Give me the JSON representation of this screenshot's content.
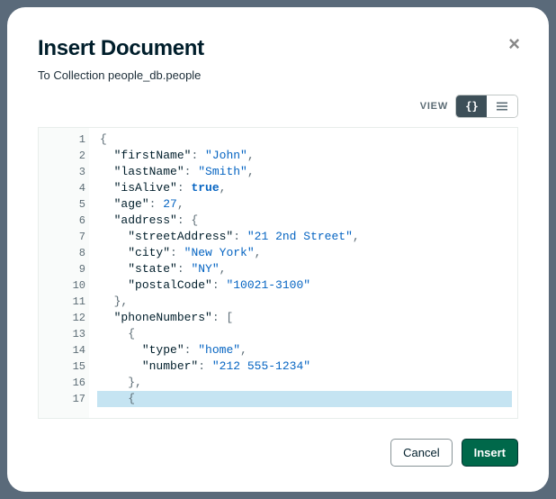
{
  "modal": {
    "title": "Insert Document",
    "subtitle": "To Collection people_db.people",
    "close_icon": "×"
  },
  "view": {
    "label": "VIEW"
  },
  "editor": {
    "lines": [
      {
        "num": "1",
        "fold": true,
        "indent": 0,
        "tokens": [
          [
            "punc",
            "{"
          ]
        ]
      },
      {
        "num": "2",
        "fold": false,
        "indent": 1,
        "tokens": [
          [
            "key",
            "\"firstName\""
          ],
          [
            "punc",
            ": "
          ],
          [
            "str",
            "\"John\""
          ],
          [
            "punc",
            ","
          ]
        ]
      },
      {
        "num": "3",
        "fold": false,
        "indent": 1,
        "tokens": [
          [
            "key",
            "\"lastName\""
          ],
          [
            "punc",
            ": "
          ],
          [
            "str",
            "\"Smith\""
          ],
          [
            "punc",
            ","
          ]
        ]
      },
      {
        "num": "4",
        "fold": false,
        "indent": 1,
        "tokens": [
          [
            "key",
            "\"isAlive\""
          ],
          [
            "punc",
            ": "
          ],
          [
            "bool",
            "true"
          ],
          [
            "punc",
            ","
          ]
        ]
      },
      {
        "num": "5",
        "fold": false,
        "indent": 1,
        "tokens": [
          [
            "key",
            "\"age\""
          ],
          [
            "punc",
            ": "
          ],
          [
            "num",
            "27"
          ],
          [
            "punc",
            ","
          ]
        ]
      },
      {
        "num": "6",
        "fold": true,
        "indent": 1,
        "tokens": [
          [
            "key",
            "\"address\""
          ],
          [
            "punc",
            ": {"
          ]
        ]
      },
      {
        "num": "7",
        "fold": false,
        "indent": 2,
        "tokens": [
          [
            "key",
            "\"streetAddress\""
          ],
          [
            "punc",
            ": "
          ],
          [
            "str",
            "\"21 2nd Street\""
          ],
          [
            "punc",
            ","
          ]
        ]
      },
      {
        "num": "8",
        "fold": false,
        "indent": 2,
        "tokens": [
          [
            "key",
            "\"city\""
          ],
          [
            "punc",
            ": "
          ],
          [
            "str",
            "\"New York\""
          ],
          [
            "punc",
            ","
          ]
        ]
      },
      {
        "num": "9",
        "fold": false,
        "indent": 2,
        "tokens": [
          [
            "key",
            "\"state\""
          ],
          [
            "punc",
            ": "
          ],
          [
            "str",
            "\"NY\""
          ],
          [
            "punc",
            ","
          ]
        ]
      },
      {
        "num": "10",
        "fold": false,
        "indent": 2,
        "tokens": [
          [
            "key",
            "\"postalCode\""
          ],
          [
            "punc",
            ": "
          ],
          [
            "str",
            "\"10021-3100\""
          ]
        ]
      },
      {
        "num": "11",
        "fold": false,
        "indent": 1,
        "tokens": [
          [
            "punc",
            "},"
          ]
        ]
      },
      {
        "num": "12",
        "fold": true,
        "indent": 1,
        "tokens": [
          [
            "key",
            "\"phoneNumbers\""
          ],
          [
            "punc",
            ": ["
          ]
        ]
      },
      {
        "num": "13",
        "fold": true,
        "indent": 2,
        "tokens": [
          [
            "punc",
            "{"
          ]
        ]
      },
      {
        "num": "14",
        "fold": false,
        "indent": 3,
        "tokens": [
          [
            "key",
            "\"type\""
          ],
          [
            "punc",
            ": "
          ],
          [
            "str",
            "\"home\""
          ],
          [
            "punc",
            ","
          ]
        ]
      },
      {
        "num": "15",
        "fold": false,
        "indent": 3,
        "tokens": [
          [
            "key",
            "\"number\""
          ],
          [
            "punc",
            ": "
          ],
          [
            "str",
            "\"212 555-1234\""
          ]
        ]
      },
      {
        "num": "16",
        "fold": false,
        "indent": 2,
        "tokens": [
          [
            "punc",
            "},"
          ]
        ]
      },
      {
        "num": "17",
        "fold": true,
        "indent": 2,
        "highlighted": true,
        "tokens": [
          [
            "punc",
            "{"
          ]
        ]
      }
    ]
  },
  "buttons": {
    "cancel": "Cancel",
    "insert": "Insert"
  }
}
